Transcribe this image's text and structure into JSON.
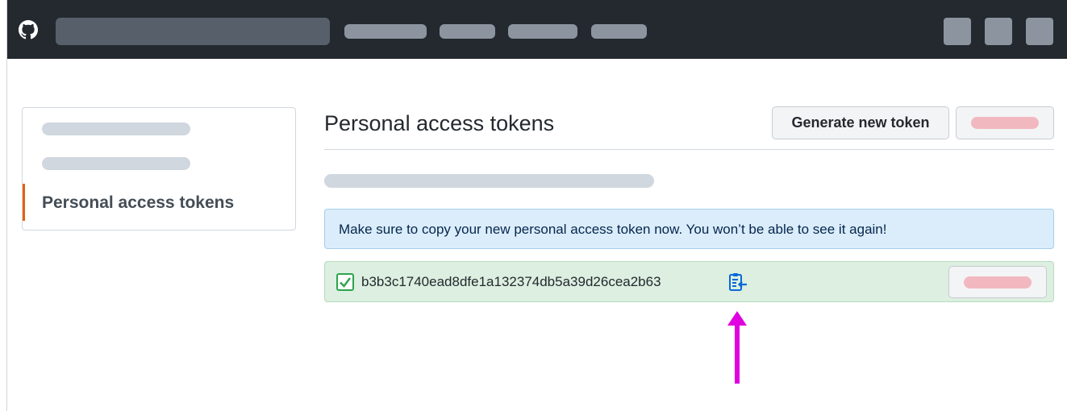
{
  "colors": {
    "topbar": "#24292f",
    "accent_active": "#e36209",
    "info_bg": "#dbedfb",
    "success_bg": "#dcefe0",
    "annotation_arrow": "#e000e0"
  },
  "sidebar": {
    "active_item_label": "Personal access tokens"
  },
  "main": {
    "title": "Personal access tokens",
    "generate_button_label": "Generate new token",
    "info_message": "Make sure to copy your new personal access token now. You won’t be able to see it again!",
    "token": {
      "value": "b3b3c1740ead8dfe1a132374db5a39d26cea2b63",
      "status_icon": "check-icon",
      "copy_icon": "clipboard-copy-icon"
    }
  }
}
